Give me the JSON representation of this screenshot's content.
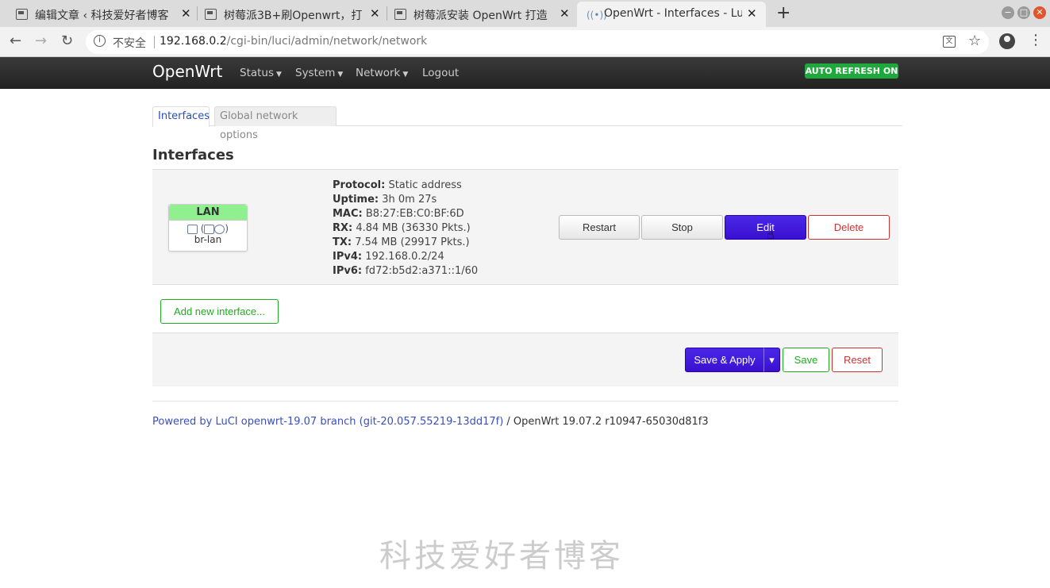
{
  "browser": {
    "tabs": [
      {
        "title": "编辑文章 ‹ 科技爱好者博客"
      },
      {
        "title": "树莓派3B+刷Openwrt，打"
      },
      {
        "title": "树莓派安装 OpenWrt 打造"
      },
      {
        "title": "OpenWrt - Interfaces - LuCI"
      }
    ],
    "insecure_label": "不安全",
    "url_host": "192.168.0.2",
    "url_path": "/cgi-bin/luci/admin/network/network"
  },
  "header": {
    "brand": "OpenWrt",
    "menu": [
      {
        "label": "Status"
      },
      {
        "label": "System"
      },
      {
        "label": "Network"
      },
      {
        "label": "Logout"
      }
    ],
    "auto_refresh": "AUTO REFRESH ON"
  },
  "subtabs": {
    "interfaces": "Interfaces",
    "global": "Global network options"
  },
  "section_title": "Interfaces",
  "interface": {
    "name": "LAN",
    "device": "br-lan",
    "status": [
      {
        "key": "Protocol:",
        "value": "Static address"
      },
      {
        "key": "Uptime:",
        "value": "3h 0m 27s"
      },
      {
        "key": "MAC:",
        "value": "B8:27:EB:C0:BF:6D"
      },
      {
        "key": "RX:",
        "value": "4.84 MB (36330 Pkts.)"
      },
      {
        "key": "TX:",
        "value": "7.54 MB (29917 Pkts.)"
      },
      {
        "key": "IPv4:",
        "value": "192.168.0.2/24"
      },
      {
        "key": "IPv6:",
        "value": "fd72:b5d2:a371::1/60"
      }
    ],
    "buttons": {
      "restart": "Restart",
      "stop": "Stop",
      "edit": "Edit",
      "delete": "Delete"
    }
  },
  "add_interface": "Add new interface...",
  "actions": {
    "save_apply": "Save & Apply",
    "dropdown": "▾",
    "save": "Save",
    "reset": "Reset"
  },
  "footer": {
    "link": "Powered by LuCI openwrt-19.07 branch (git-20.057.55219-13dd17f)",
    "version": " / OpenWrt 19.07.2 r10947-65030d81f3"
  },
  "watermark": "科技爱好者博客",
  "colors": {
    "primary": "#3a10d0",
    "badge_green": "#90f090",
    "auto_refresh": "#1fa83b",
    "negative": "#cc3333",
    "positive": "#22aa22"
  }
}
